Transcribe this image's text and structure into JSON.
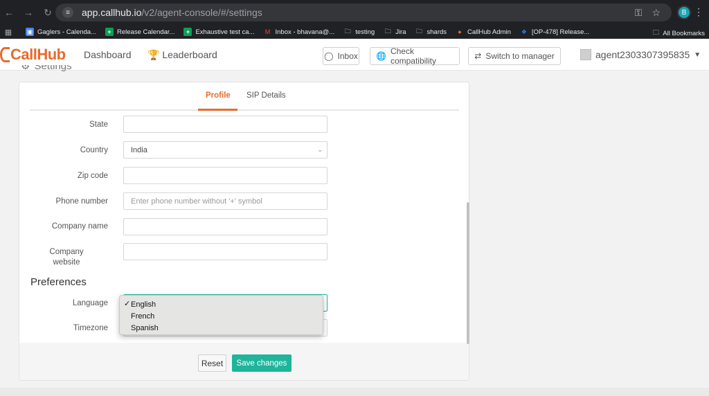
{
  "browser": {
    "url_host": "app.callhub.io",
    "url_path": "/v2/agent-console/#/settings",
    "profile_initial": "B",
    "bookmarks": [
      {
        "label": "Gaglers - Calenda...",
        "icon": "calendar-icon",
        "color": "#4285f4"
      },
      {
        "label": "Release Calendar...",
        "icon": "sheets-icon",
        "color": "#0f9d58"
      },
      {
        "label": "Exhaustive test ca...",
        "icon": "sheets-icon",
        "color": "#0f9d58"
      },
      {
        "label": "Inbox - bhavana@...",
        "icon": "gmail-icon",
        "color": "#ea4335"
      },
      {
        "label": "testing",
        "icon": "folder-icon",
        "color": "#e8eaed"
      },
      {
        "label": "Jira",
        "icon": "folder-icon",
        "color": "#e8eaed"
      },
      {
        "label": "shards",
        "icon": "folder-icon",
        "color": "#e8eaed"
      },
      {
        "label": "CallHub Admin",
        "icon": "callhub-icon",
        "color": "#e86a2c"
      },
      {
        "label": "[OP-478] Release...",
        "icon": "jira-icon",
        "color": "#2684ff"
      }
    ],
    "all_bookmarks": "All Bookmarks"
  },
  "header": {
    "logo": "CallHub",
    "nav_dashboard": "Dashboard",
    "nav_leaderboard": "Leaderboard",
    "btn_inbox": "Inbox",
    "btn_check": "Check compatibility",
    "btn_switch": "Switch to manager",
    "username": "agent2303307395835"
  },
  "settings_title": "Settings",
  "tabs": {
    "profile": "Profile",
    "sip": "SIP Details"
  },
  "form": {
    "state_label": "State",
    "state_value": "",
    "country_label": "Country",
    "country_value": "India",
    "zip_label": "Zip code",
    "zip_value": "",
    "phone_label": "Phone number",
    "phone_placeholder": "Enter phone number without '+' symbol",
    "company_label": "Company name",
    "company_value": "",
    "website_label_1": "Company",
    "website_label_2": "website",
    "website_value": ""
  },
  "preferences": {
    "title": "Preferences",
    "language_label": "Language",
    "timezone_label": "Timezone",
    "language_options": [
      "English",
      "French",
      "Spanish"
    ],
    "language_selected": "English"
  },
  "actions": {
    "reset": "Reset",
    "save": "Save changes"
  },
  "colors": {
    "brand": "#e86a2c",
    "save": "#1eb59a"
  }
}
